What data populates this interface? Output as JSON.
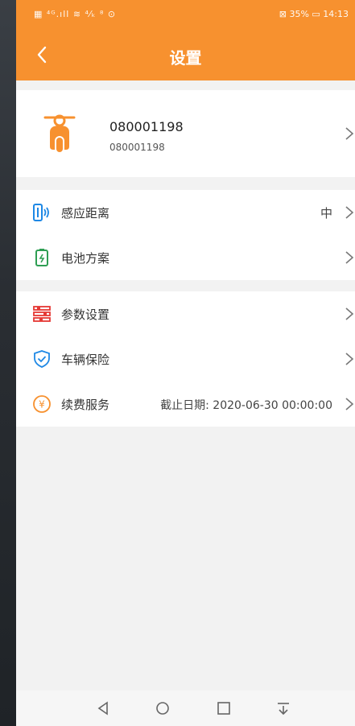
{
  "status_bar": {
    "left_icons": "▦ ⁴ᴳ.ıll ≋ ⁴⁄ₖ ⁸ ⊙",
    "right_text": "⊠ 35% ▭ 14:13"
  },
  "header": {
    "title": "设置",
    "back_icon": "chevron-left-icon"
  },
  "vehicle": {
    "name": "080001198",
    "subtitle": "080001198",
    "icon": "scooter-icon"
  },
  "group1": [
    {
      "label": "感应距离",
      "value": "中",
      "icon": "phone-signal-icon"
    },
    {
      "label": "电池方案",
      "value": "",
      "icon": "battery-icon"
    }
  ],
  "group2": [
    {
      "label": "参数设置",
      "value": "",
      "icon": "sliders-icon"
    },
    {
      "label": "车辆保险",
      "value": "",
      "icon": "shield-check-icon"
    },
    {
      "label": "续费服务",
      "value": "截止日期: 2020-06-30 00:00:00",
      "icon": "yen-coin-icon"
    }
  ],
  "nav_bar": [
    "back-triangle-icon",
    "home-circle-icon",
    "recents-square-icon",
    "notification-pull-icon"
  ],
  "colors": {
    "accent": "#f7912f",
    "blue": "#1e88e5",
    "green": "#2e9e53",
    "red": "#e53935"
  }
}
